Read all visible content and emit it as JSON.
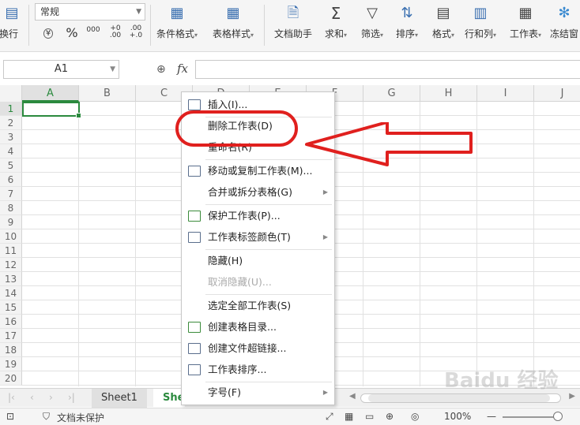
{
  "ribbon": {
    "left_fragment": "换行",
    "number_format": "常规",
    "num_symbols": {
      "currency": "¥",
      "percent": "%",
      "thousands": "000",
      "inc_decimal": "+0 .00",
      "dec_decimal": ".00 +.0"
    },
    "buttons": [
      {
        "label": "条件格式",
        "icon": "conditional-format-icon"
      },
      {
        "label": "表格样式",
        "icon": "table-style-icon"
      },
      {
        "label": "文档助手",
        "icon": "doc-assistant-icon"
      },
      {
        "label": "求和",
        "icon": "sum-icon"
      },
      {
        "label": "筛选",
        "icon": "filter-icon"
      },
      {
        "label": "排序",
        "icon": "sort-icon"
      },
      {
        "label": "格式",
        "icon": "format-icon"
      },
      {
        "label": "行和列",
        "icon": "rows-cols-icon"
      },
      {
        "label": "工作表",
        "icon": "worksheet-icon"
      },
      {
        "label": "冻结窗",
        "icon": "freeze-icon"
      }
    ]
  },
  "formula_bar": {
    "name_box": "A1",
    "fx": "fx",
    "value": ""
  },
  "grid": {
    "columns": [
      "A",
      "B",
      "C",
      "D",
      "E",
      "F",
      "G",
      "H",
      "I",
      "J"
    ],
    "rows": [
      "1",
      "2",
      "3",
      "4",
      "5",
      "6",
      "7",
      "8",
      "9",
      "10",
      "11",
      "12",
      "13",
      "14",
      "15",
      "16",
      "17",
      "18",
      "19",
      "20"
    ],
    "active_cell": "A1"
  },
  "context_menu": {
    "items": [
      {
        "label": "插入(I)...",
        "icon": "insert-icon",
        "submenu": false,
        "disabled": false
      },
      {
        "label": "删除工作表(D)",
        "icon": "",
        "submenu": false,
        "disabled": false
      },
      {
        "label": "重命名(R)",
        "icon": "",
        "submenu": false,
        "disabled": false
      },
      {
        "label": "移动或复制工作表(M)...",
        "icon": "move-copy-icon",
        "submenu": false,
        "disabled": false
      },
      {
        "label": "合并或拆分表格(G)",
        "icon": "",
        "submenu": true,
        "disabled": false
      },
      {
        "label": "保护工作表(P)...",
        "icon": "protect-sheet-icon",
        "submenu": false,
        "disabled": false
      },
      {
        "label": "工作表标签颜色(T)",
        "icon": "tab-color-icon",
        "submenu": true,
        "disabled": false
      },
      {
        "label": "隐藏(H)",
        "icon": "",
        "submenu": false,
        "disabled": false
      },
      {
        "label": "取消隐藏(U)...",
        "icon": "",
        "submenu": false,
        "disabled": true
      },
      {
        "label": "选定全部工作表(S)",
        "icon": "",
        "submenu": false,
        "disabled": false
      },
      {
        "label": "创建表格目录...",
        "icon": "table-toc-icon",
        "submenu": false,
        "disabled": false
      },
      {
        "label": "创建文件超链接...",
        "icon": "hyperlink-icon",
        "submenu": false,
        "disabled": false
      },
      {
        "label": "工作表排序...",
        "icon": "sheet-sort-icon",
        "submenu": false,
        "disabled": false
      },
      {
        "label": "字号(F)",
        "icon": "",
        "submenu": true,
        "disabled": false
      }
    ]
  },
  "sheet_tabs": {
    "tabs": [
      "Sheet1",
      "Shee"
    ],
    "active": "Shee"
  },
  "status_bar": {
    "protect_status": "文档未保护",
    "zoom": "100%"
  },
  "annotation": {
    "color": "#e0201e"
  },
  "watermark": "Baidu 经验"
}
